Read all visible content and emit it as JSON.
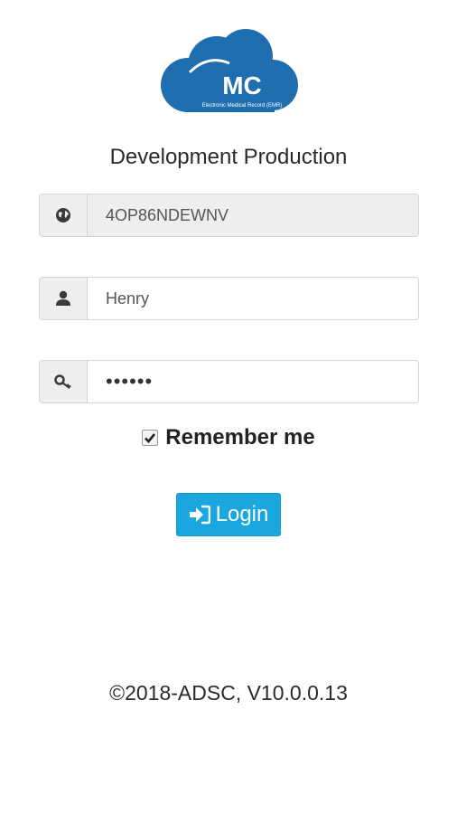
{
  "logo": {
    "initials": "MC",
    "tagline": "Electronic Medical Record (EMR)",
    "color": "#1f6fb0"
  },
  "environment_title": "Development Production",
  "fields": {
    "code": {
      "value": "4OP86NDEWNV",
      "icon": "globe-icon"
    },
    "username": {
      "value": "Henry",
      "icon": "user-icon"
    },
    "password": {
      "value": "••••••",
      "icon": "key-icon"
    }
  },
  "remember_me": {
    "label": "Remember me",
    "checked": true
  },
  "login_button": {
    "label": "Login",
    "icon": "sign-in-icon",
    "color": "#1aa6df"
  },
  "footer": {
    "text": "©2018-ADSC, V10.0.0.13"
  }
}
